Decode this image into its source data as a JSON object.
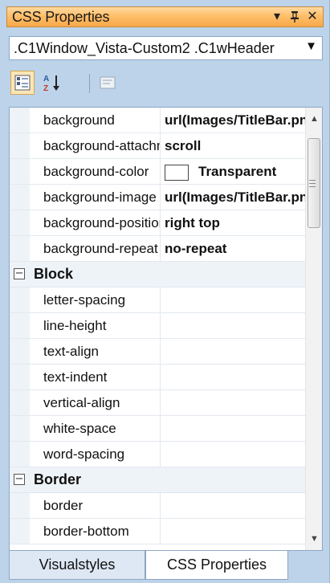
{
  "panel": {
    "title": "CSS Properties",
    "title_buttons": {
      "dropdown": "▾",
      "pin": "ᚁ",
      "close": "✕"
    }
  },
  "selector": {
    "value": ".C1Window_Vista-Custom2 .C1wHeader",
    "arrow": "▼"
  },
  "toolbar": {
    "categorized_icon": "categorized-icon",
    "alphabetical_icon": "alphabetical-icon",
    "property_pages_icon": "property-pages-icon"
  },
  "grid": {
    "rows": [
      {
        "name": "background",
        "value": "url(Images/TitleBar.png)"
      },
      {
        "name": "background-attachment",
        "value": "scroll"
      },
      {
        "name": "background-color",
        "value": "Transparent",
        "swatch": "#ffffff"
      },
      {
        "name": "background-image",
        "value": "url(Images/TitleBar.png)"
      },
      {
        "name": "background-position",
        "value": "right top"
      },
      {
        "name": "background-repeat",
        "value": "no-repeat"
      }
    ],
    "categories": [
      {
        "title": "Block",
        "toggle": "⊟",
        "rows": [
          {
            "name": "letter-spacing",
            "value": ""
          },
          {
            "name": "line-height",
            "value": ""
          },
          {
            "name": "text-align",
            "value": ""
          },
          {
            "name": "text-indent",
            "value": ""
          },
          {
            "name": "vertical-align",
            "value": ""
          },
          {
            "name": "white-space",
            "value": ""
          },
          {
            "name": "word-spacing",
            "value": ""
          }
        ]
      },
      {
        "title": "Border",
        "toggle": "⊟",
        "rows": [
          {
            "name": "border",
            "value": ""
          },
          {
            "name": "border-bottom",
            "value": ""
          }
        ]
      }
    ]
  },
  "tabs": [
    {
      "label": "Visualstyles",
      "active": true
    },
    {
      "label": "CSS Properties",
      "active": false
    }
  ],
  "colors": {
    "title_bar": "#ffbf6a",
    "panel_bg": "#bcd3ea",
    "grid_border": "#8ea7c4"
  }
}
